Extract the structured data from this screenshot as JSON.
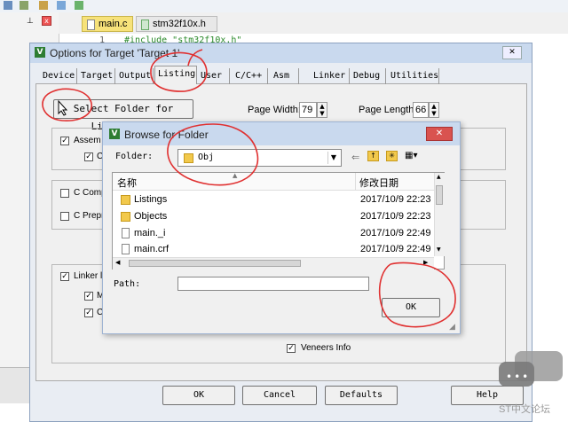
{
  "editor": {
    "tabs": [
      "main.c",
      "stm32f10x.h"
    ],
    "code_line_number": "1",
    "code_line_text": "#include \"stm32f10x.h\""
  },
  "options_dialog": {
    "title": "Options for Target 'Target 1'",
    "close": "✕",
    "tabs": [
      "Device",
      "Target",
      "Output",
      "Listing",
      "User",
      "C/C++",
      "Asm",
      "Linker",
      "Debug",
      "Utilities"
    ],
    "select_folder_button": "Select Folder for Listings...",
    "page_width_label": "Page Width:",
    "page_width_value": "79",
    "page_length_label": "Page Length:",
    "page_length_value": "66",
    "assembler_label": "Assem",
    "assembler_sub": "C",
    "c_compiler_label": "C Comp",
    "c_preprocessor_label": "C Prepr",
    "linker_label": "Linker l",
    "linker_sub1": "M",
    "linker_sub2": "C",
    "veneers_label": "Veneers Info",
    "ok_button": "OK",
    "cancel_button": "Cancel",
    "defaults_button": "Defaults",
    "help_button": "Help"
  },
  "browse_dialog": {
    "title": "Browse for Folder",
    "folder_label": "Folder:",
    "folder_value": "Obj",
    "columns": [
      "名称",
      "修改日期"
    ],
    "rows": [
      {
        "name": "Listings",
        "date": "2017/10/9 22:23",
        "type": "folder"
      },
      {
        "name": "Objects",
        "date": "2017/10/9 22:23",
        "type": "folder"
      },
      {
        "name": "main._i",
        "date": "2017/10/9 22:49",
        "type": "file"
      },
      {
        "name": "main.crf",
        "date": "2017/10/9 22:49",
        "type": "file"
      }
    ],
    "path_label": "Path:",
    "path_value": "",
    "ok_button": "OK",
    "close": "✕"
  },
  "watermark": "ST中文论坛",
  "colors": {
    "titlebar": "#c9d9ee",
    "annotation": "#e03030",
    "browse_border": "#9fb4d3"
  }
}
